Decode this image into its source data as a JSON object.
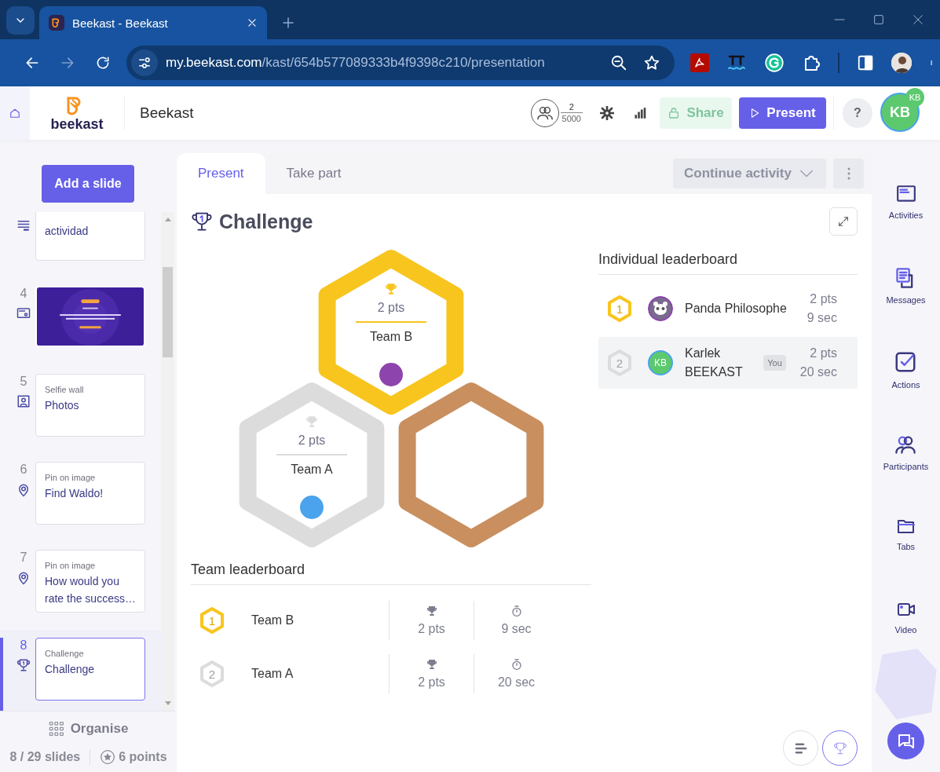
{
  "browser": {
    "tab_title": "Beekast - Beekast",
    "address": {
      "host": "my.beekast.com",
      "path": "/kast/654b577089333b4f9398c210/presentation"
    }
  },
  "header": {
    "logo": "beekast",
    "title": "Beekast",
    "participants": {
      "count": "2",
      "max": "5000"
    },
    "share": {
      "label": "Share",
      "disabled": true
    },
    "present": "Present",
    "help": "?",
    "avatar": {
      "initials": "KB",
      "badge": "KB"
    }
  },
  "sidebar": {
    "add_button": "Add a slide",
    "slides": [
      {
        "kind": "form",
        "title": "actividad",
        "selected": false
      },
      {
        "number": "4",
        "selected": false
      },
      {
        "number": "5",
        "kind": "selfie",
        "type": "Selfie wall",
        "title": "Photos",
        "selected": false
      },
      {
        "number": "6",
        "kind": "pin",
        "type": "Pin on image",
        "title": "Find Waldo!",
        "selected": false
      },
      {
        "number": "7",
        "kind": "pin",
        "type": "Pin on image",
        "title": "How would you rate the success…",
        "selected": false
      },
      {
        "number": "8",
        "kind": "challenge",
        "type": "Challenge",
        "title": "Challenge",
        "selected": true
      }
    ],
    "organise": "Organise",
    "slide_count": "8 / 29 slides",
    "points": "6 points"
  },
  "panel": {
    "tabs": [
      {
        "label": "Present",
        "selected": true
      },
      {
        "label": "Take part",
        "selected": false
      }
    ],
    "activity_dropdown": {
      "label": "Continue activity",
      "disabled": true
    },
    "title": "Challenge",
    "podium": [
      {
        "kind": "gold",
        "points": "2 pts",
        "team": "Team B",
        "color": "#8e44ad"
      },
      {
        "kind": "silver",
        "points": "2 pts",
        "team": "Team A",
        "color": "#4aa3ec"
      },
      {
        "kind": "bronze"
      }
    ],
    "individual": {
      "title": "Individual leaderboard",
      "rows": [
        {
          "rank": "1",
          "kind": "gold",
          "avatar": {
            "kind": "panda"
          },
          "name": "Panda Philosophe",
          "points": "2 pts",
          "time": "9 sec",
          "highlighted": false
        },
        {
          "rank": "2",
          "kind": "silver",
          "avatar": {
            "kind": "initials",
            "initials": "KB"
          },
          "name": "Karlek BEEKAST",
          "badge": "You",
          "points": "2 pts",
          "time": "20 sec",
          "highlighted": true
        }
      ]
    },
    "teams": {
      "title": "Team leaderboard",
      "rows": [
        {
          "rank": "1",
          "kind": "gold",
          "team": "Team B",
          "points": "2 pts",
          "time": "9 sec"
        },
        {
          "rank": "2",
          "kind": "silver",
          "team": "Team A",
          "points": "2 pts",
          "time": "20 sec"
        }
      ]
    },
    "views": [
      {
        "kind": "bars",
        "selected": false
      },
      {
        "kind": "trophy",
        "selected": true
      }
    ]
  },
  "rail": [
    {
      "kind": "activities",
      "label": "Activities"
    },
    {
      "kind": "messages",
      "label": "Messages"
    },
    {
      "kind": "actions",
      "label": "Actions"
    },
    {
      "kind": "participants",
      "label": "Participants"
    },
    {
      "kind": "tabs",
      "label": "Tabs"
    },
    {
      "kind": "video",
      "label": "Video"
    }
  ]
}
